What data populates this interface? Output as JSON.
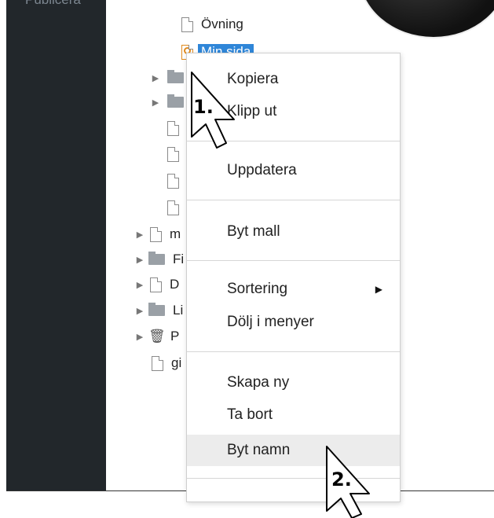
{
  "sidebar": {
    "label": "Publicera"
  },
  "tree": {
    "items": [
      {
        "type": "doc",
        "label": "Övning"
      },
      {
        "type": "doc-special",
        "label": "Min sida",
        "selected": true
      },
      {
        "type": "folder",
        "label": ""
      },
      {
        "type": "folder",
        "label": ""
      },
      {
        "type": "doc",
        "label": ""
      },
      {
        "type": "doc",
        "label": ""
      },
      {
        "type": "doc",
        "label": ""
      },
      {
        "type": "doc",
        "label": ""
      },
      {
        "type": "doc",
        "label": "m"
      },
      {
        "type": "folder",
        "label": "Fi"
      },
      {
        "type": "doc",
        "label": "D"
      },
      {
        "type": "folder",
        "label": "Li"
      },
      {
        "type": "trash",
        "label": "P"
      },
      {
        "type": "doc",
        "label": "gi"
      }
    ]
  },
  "context_menu": {
    "items": [
      {
        "label": "Kopiera"
      },
      {
        "label": "Klipp ut"
      },
      {
        "label": "Uppdatera"
      },
      {
        "label": "Byt mall"
      },
      {
        "label": "Sortering",
        "has_submenu": true,
        "submenu_icon": "triangle-right-icon"
      },
      {
        "label": "Dölj i menyer"
      },
      {
        "label": "Skapa ny"
      },
      {
        "label": "Ta bort"
      },
      {
        "label": "Byt namn",
        "highlighted": true
      }
    ]
  },
  "annotations": {
    "step1": "1.",
    "step2": "2."
  },
  "colors": {
    "sidebar_bg": "#22272b",
    "selection": "#2f86d8",
    "hover": "#ececec"
  }
}
